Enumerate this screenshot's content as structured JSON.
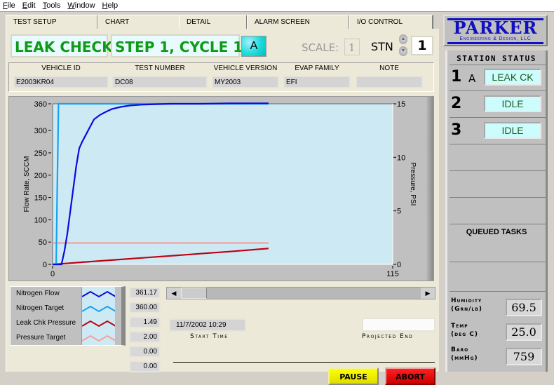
{
  "menu": [
    "File",
    "Edit",
    "Tools",
    "Window",
    "Help"
  ],
  "tabs": [
    {
      "label": "TEST SETUP",
      "active": false
    },
    {
      "label": "CHART",
      "active": true
    },
    {
      "label": "DETAIL",
      "active": false
    },
    {
      "label": "ALARM SCREEN",
      "active": false
    },
    {
      "label": "I/O CONTROL",
      "active": false
    }
  ],
  "header": {
    "mode": "LEAK CHECK",
    "step": "STEP 1, CYCLE  1",
    "station_letter": "A",
    "scale_label": "SCALE:",
    "scale_value": "1",
    "stn_label": "STN",
    "stn_value": "1",
    "spin_up": "▲",
    "spin_down": "▼"
  },
  "info": [
    {
      "label": "VEHICLE ID",
      "value": "E2003KR04"
    },
    {
      "label": "TEST NUMBER",
      "value": "DC08"
    },
    {
      "label": "VEHICLE VERSION",
      "value": "MY2003"
    },
    {
      "label": "EVAP FAMILY",
      "value": "EFI"
    },
    {
      "label": "NOTE",
      "value": ""
    }
  ],
  "chart_data": {
    "type": "line",
    "title": "",
    "xlabel": "",
    "ylabel": "Flow Rate, SCCM",
    "y2label": "Pressure, PSI",
    "xlim": [
      0,
      115
    ],
    "ylim": [
      0,
      360
    ],
    "y2lim": [
      0,
      15
    ],
    "x_ticks": [
      "0",
      "115"
    ],
    "y_ticks": [
      0,
      50,
      100,
      150,
      200,
      250,
      300,
      360
    ],
    "y2_ticks": [
      0,
      5,
      10,
      15
    ],
    "background": "#cdeaf4",
    "series": [
      {
        "name": "Nitrogen Flow",
        "axis": "left",
        "color": "#0a0ae0",
        "x": [
          0,
          2,
          3,
          4,
          5,
          6,
          7,
          8,
          9,
          10,
          12,
          14,
          16,
          18,
          20,
          23,
          26,
          30,
          35,
          40,
          45,
          50,
          60,
          73
        ],
        "y": [
          0,
          0,
          0,
          30,
          70,
          120,
          170,
          220,
          260,
          275,
          300,
          325,
          335,
          342,
          348,
          353,
          356,
          358,
          359,
          360,
          360,
          360,
          361,
          361.17
        ]
      },
      {
        "name": "Nitrogen Target",
        "axis": "left",
        "color": "#1aa0f0",
        "x": [
          0,
          1.2,
          1.4,
          1.6,
          1.8,
          2.0,
          2.2,
          73
        ],
        "y": [
          0,
          0,
          90,
          180,
          270,
          360,
          360,
          360
        ]
      },
      {
        "name": "Leak Chk Pressure",
        "axis": "right",
        "color": "#c00010",
        "x": [
          0,
          3,
          10,
          20,
          30,
          40,
          50,
          60,
          73
        ],
        "y": [
          0,
          0.05,
          0.2,
          0.4,
          0.6,
          0.8,
          1.0,
          1.2,
          1.49
        ]
      },
      {
        "name": "Pressure Target",
        "axis": "right",
        "color": "#f4a0a0",
        "x": [
          0,
          73
        ],
        "y": [
          2.0,
          2.0
        ]
      }
    ],
    "legend_position": "bottom-left",
    "grid": false
  },
  "readouts": [
    "361.17",
    "360.00",
    "1.49",
    "2.00",
    "0.00",
    "0.00"
  ],
  "timing": {
    "start_time": "11/7/2002 10:29",
    "start_label": "Start Time",
    "projected_end": "",
    "projected_label": "Projected End"
  },
  "buttons": {
    "pause": "PAUSE",
    "abort": "ABORT"
  },
  "scroll": {
    "left": "◀",
    "right": "▶"
  },
  "sidebar": {
    "logo_name": "PARKER",
    "logo_sub": "Engineering & Design, LLC",
    "status_title": "STATION STATUS",
    "stations": [
      {
        "num": "1",
        "letter": "A",
        "status": "LEAK CK"
      },
      {
        "num": "2",
        "letter": "",
        "status": "IDLE"
      },
      {
        "num": "3",
        "letter": "",
        "status": "IDLE"
      }
    ],
    "queued_label": "QUEUED TASKS",
    "env": [
      {
        "label1": "Humidity",
        "label2": "(Grn/lb)",
        "value": "69.5"
      },
      {
        "label1": "Temp",
        "label2": "(deg C)",
        "value": "25.0"
      },
      {
        "label1": "Baro",
        "label2": "(mmHg)",
        "value": "759"
      }
    ]
  }
}
